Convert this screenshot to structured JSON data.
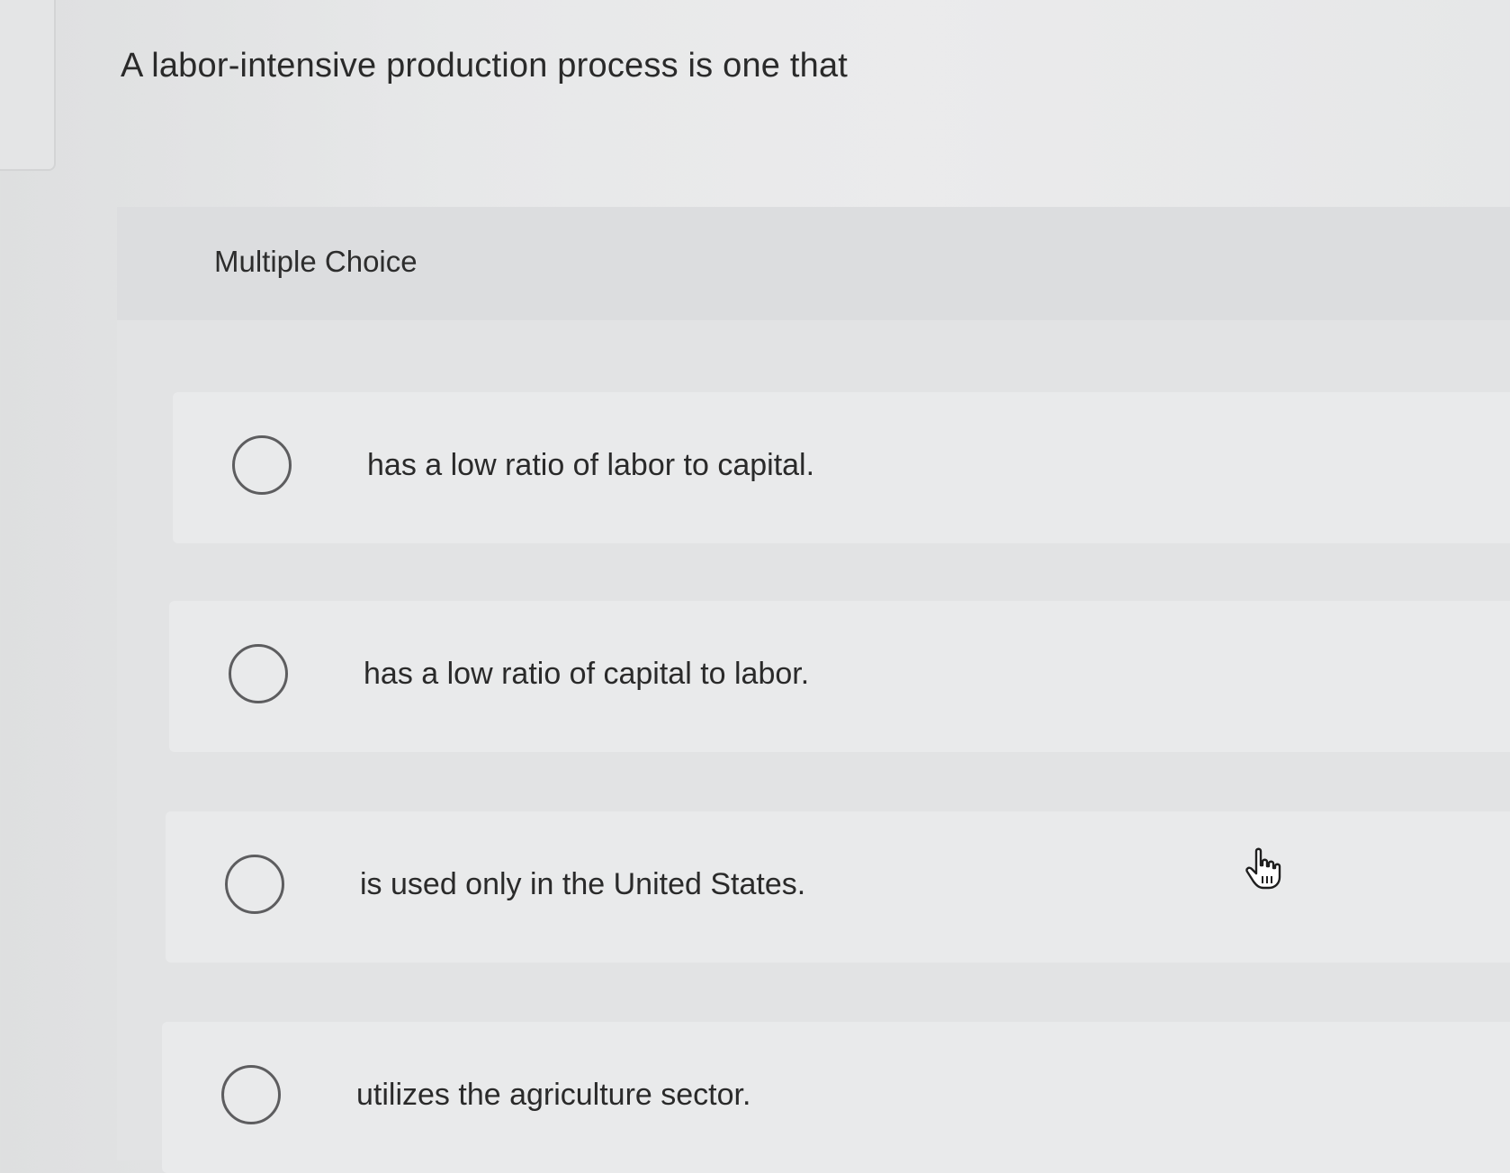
{
  "question": {
    "text": "A labor-intensive production process is one that"
  },
  "answer_panel": {
    "label": "Multiple Choice",
    "options": [
      {
        "label": "has a low ratio of labor to capital.",
        "selected": false
      },
      {
        "label": "has a low ratio of capital to labor.",
        "selected": false
      },
      {
        "label": "is used only in the United States.",
        "selected": false
      },
      {
        "label": "utilizes the agriculture sector.",
        "selected": false
      }
    ]
  },
  "cursor": {
    "icon": "hand-pointer-icon"
  },
  "colors": {
    "background": "#e7e8e9",
    "panel": "#e2e3e4",
    "option_background": "#e9eaeb",
    "radio_border": "#5d5d5f",
    "text": "#2a2a2a"
  }
}
